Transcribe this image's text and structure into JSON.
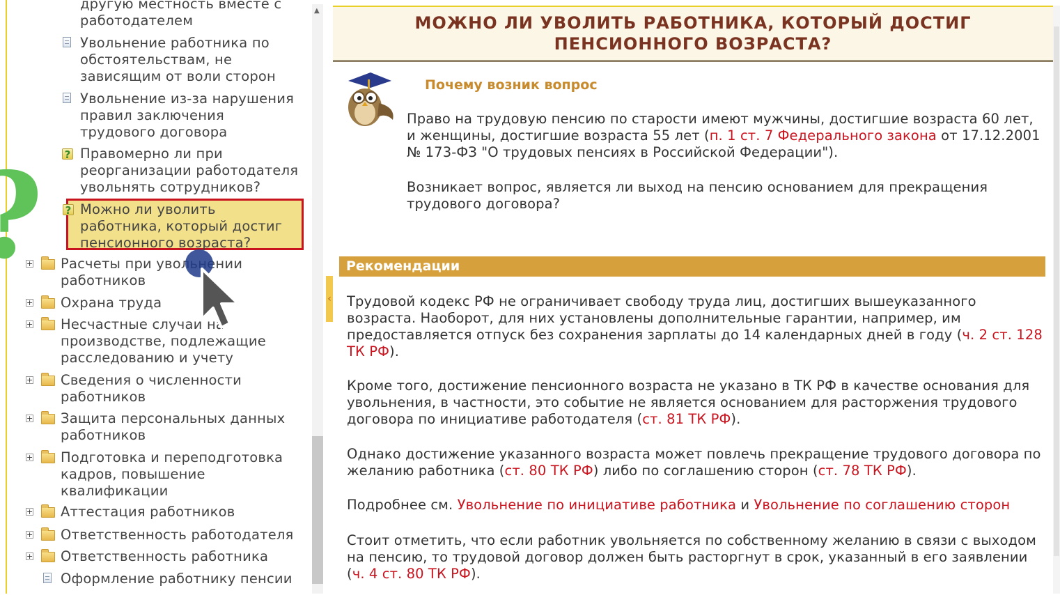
{
  "tree": {
    "items": [
      {
        "type": "doc-partial",
        "lines": [
          "другую местность вместе с",
          "работодателем"
        ]
      },
      {
        "type": "doc",
        "lines": [
          "Увольнение работника по",
          "обстоятельствам, не",
          "зависящим от воли сторон"
        ]
      },
      {
        "type": "doc",
        "lines": [
          "Увольнение из-за нарушения",
          "правил заключения",
          "трудового договора"
        ]
      },
      {
        "type": "question",
        "lines": [
          "Правомерно ли при",
          "реорганизации работодателя",
          "увольнять сотрудников?"
        ]
      },
      {
        "type": "question-selected",
        "lines": [
          "Можно ли уволить",
          "работника, который достиг",
          "пенсионного возраста?"
        ]
      },
      {
        "type": "folder",
        "lines": [
          "Расчеты при увольнении",
          "работников"
        ]
      },
      {
        "type": "folder",
        "lines": [
          "Охрана труда"
        ]
      },
      {
        "type": "folder",
        "lines": [
          "Несчастные случаи на",
          "производстве, подлежащие",
          "расследованию и учету"
        ]
      },
      {
        "type": "folder",
        "lines": [
          "Сведения о численности",
          "работников"
        ]
      },
      {
        "type": "folder",
        "lines": [
          "Защита персональных данных",
          "работников"
        ]
      },
      {
        "type": "folder",
        "lines": [
          "Подготовка и переподготовка",
          "кадров, повышение",
          "квалификации"
        ]
      },
      {
        "type": "folder",
        "lines": [
          "Аттестация работников"
        ]
      },
      {
        "type": "folder",
        "lines": [
          "Ответственность работодателя"
        ]
      },
      {
        "type": "folder",
        "lines": [
          "Ответственность работника"
        ]
      },
      {
        "type": "doc",
        "lines": [
          "Оформление работнику пенсии"
        ]
      }
    ],
    "question_glyph": "?",
    "plus_glyph": "+",
    "splitter_glyph": "‹"
  },
  "overlay": {
    "green_question_mark": "?",
    "cursor_icon": "arrow-cursor-icon"
  },
  "article": {
    "title_line1": "МОЖНО ЛИ УВОЛИТЬ РАБОТНИКА, КОТОРЫЙ ДОСТИГ",
    "title_line2": "ПЕНСИОННОГО ВОЗРАСТА?",
    "why_heading": "Почему возник вопрос",
    "p1": {
      "a": "Право на трудовую пенсию по старости имеют мужчины, достигшие возраста 60 лет,",
      "b": "и женщины, достигшие возраста 55 лет (",
      "link": "п. 1 ст. 7 Федерального закона",
      "c": " от 17.12.2001",
      "d": "№ 173-ФЗ \"О трудовых пенсиях в Российской Федерации\")."
    },
    "p2": {
      "a": "Возникает вопрос, является ли выход на пенсию основанием для прекращения",
      "b": "трудового договора?"
    },
    "rec_heading": "Рекомендации",
    "r1": {
      "a": "Трудовой кодекс РФ не ограничивает свободу труда лиц, достигших вышеуказанного",
      "b": "возраста. Наоборот, для них установлены дополнительные гарантии, например, им",
      "c": "предоставляется отпуск без сохранения зарплаты до 14 календарных дней в году (",
      "link1": "ч. 2 ст. 128",
      "link2": "ТК РФ",
      "d": ")."
    },
    "r2": {
      "a": "Кроме того, достижение пенсионного возраста не указано в ТК РФ в качестве основания для",
      "b": "увольнения, в частности, это событие не является основанием для расторжения трудового",
      "c": "договора по инициативе работодателя (",
      "link": "ст. 81 ТК РФ",
      "d": ")."
    },
    "r3": {
      "a": "Однако достижение указанного возраста может повлечь прекращение трудового договора по",
      "b": "желанию работника (",
      "link1": "ст. 80 ТК РФ",
      "c": ") либо по соглашению сторон (",
      "link2": "ст. 78 ТК РФ",
      "d": ")."
    },
    "r4": {
      "a": "Подробнее см. ",
      "link1": "Увольнение по инициативе работника",
      "b": " и ",
      "link2": "Увольнение по соглашению сторон"
    },
    "r5": {
      "a": "Стоит отметить, что если работник увольняется по собственному желанию в связи с выходом",
      "b": "на пенсию, то трудовой договор должен быть расторгнут в срок, указанный в его заявлении",
      "c": "(",
      "link": "ч. 4 ст. 80 ТК РФ",
      "d": ")."
    }
  },
  "colors": {
    "title": "#7a3320",
    "link": "#c8141e",
    "rec_bar": "#d6a03c",
    "selection_border": "#c8141e",
    "selection_fill": "#f2e08a",
    "accent_border": "#e9cf2a"
  }
}
